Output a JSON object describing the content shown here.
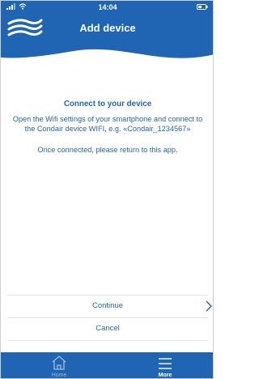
{
  "status_bar": {
    "time": "14:04"
  },
  "header": {
    "title": "Add device"
  },
  "content": {
    "heading": "Connect to your device",
    "instructions": "Open the Wifi settings of your smartphone and connect to the Condair device WIFI, e.g. «Condair_1234567»",
    "return_note": "Once connected, please return to this app."
  },
  "actions": {
    "continue_label": "Continue",
    "cancel_label": "Cancel"
  },
  "tabbar": {
    "home_label": "Home",
    "more_label": "More",
    "active_tab": "More",
    "home_icon": "home-icon",
    "more_icon": "menu-icon"
  },
  "colors": {
    "brand_blue": "#1f65b3",
    "inactive_tab": "#9fbde0",
    "divider": "#e2e2e2"
  }
}
